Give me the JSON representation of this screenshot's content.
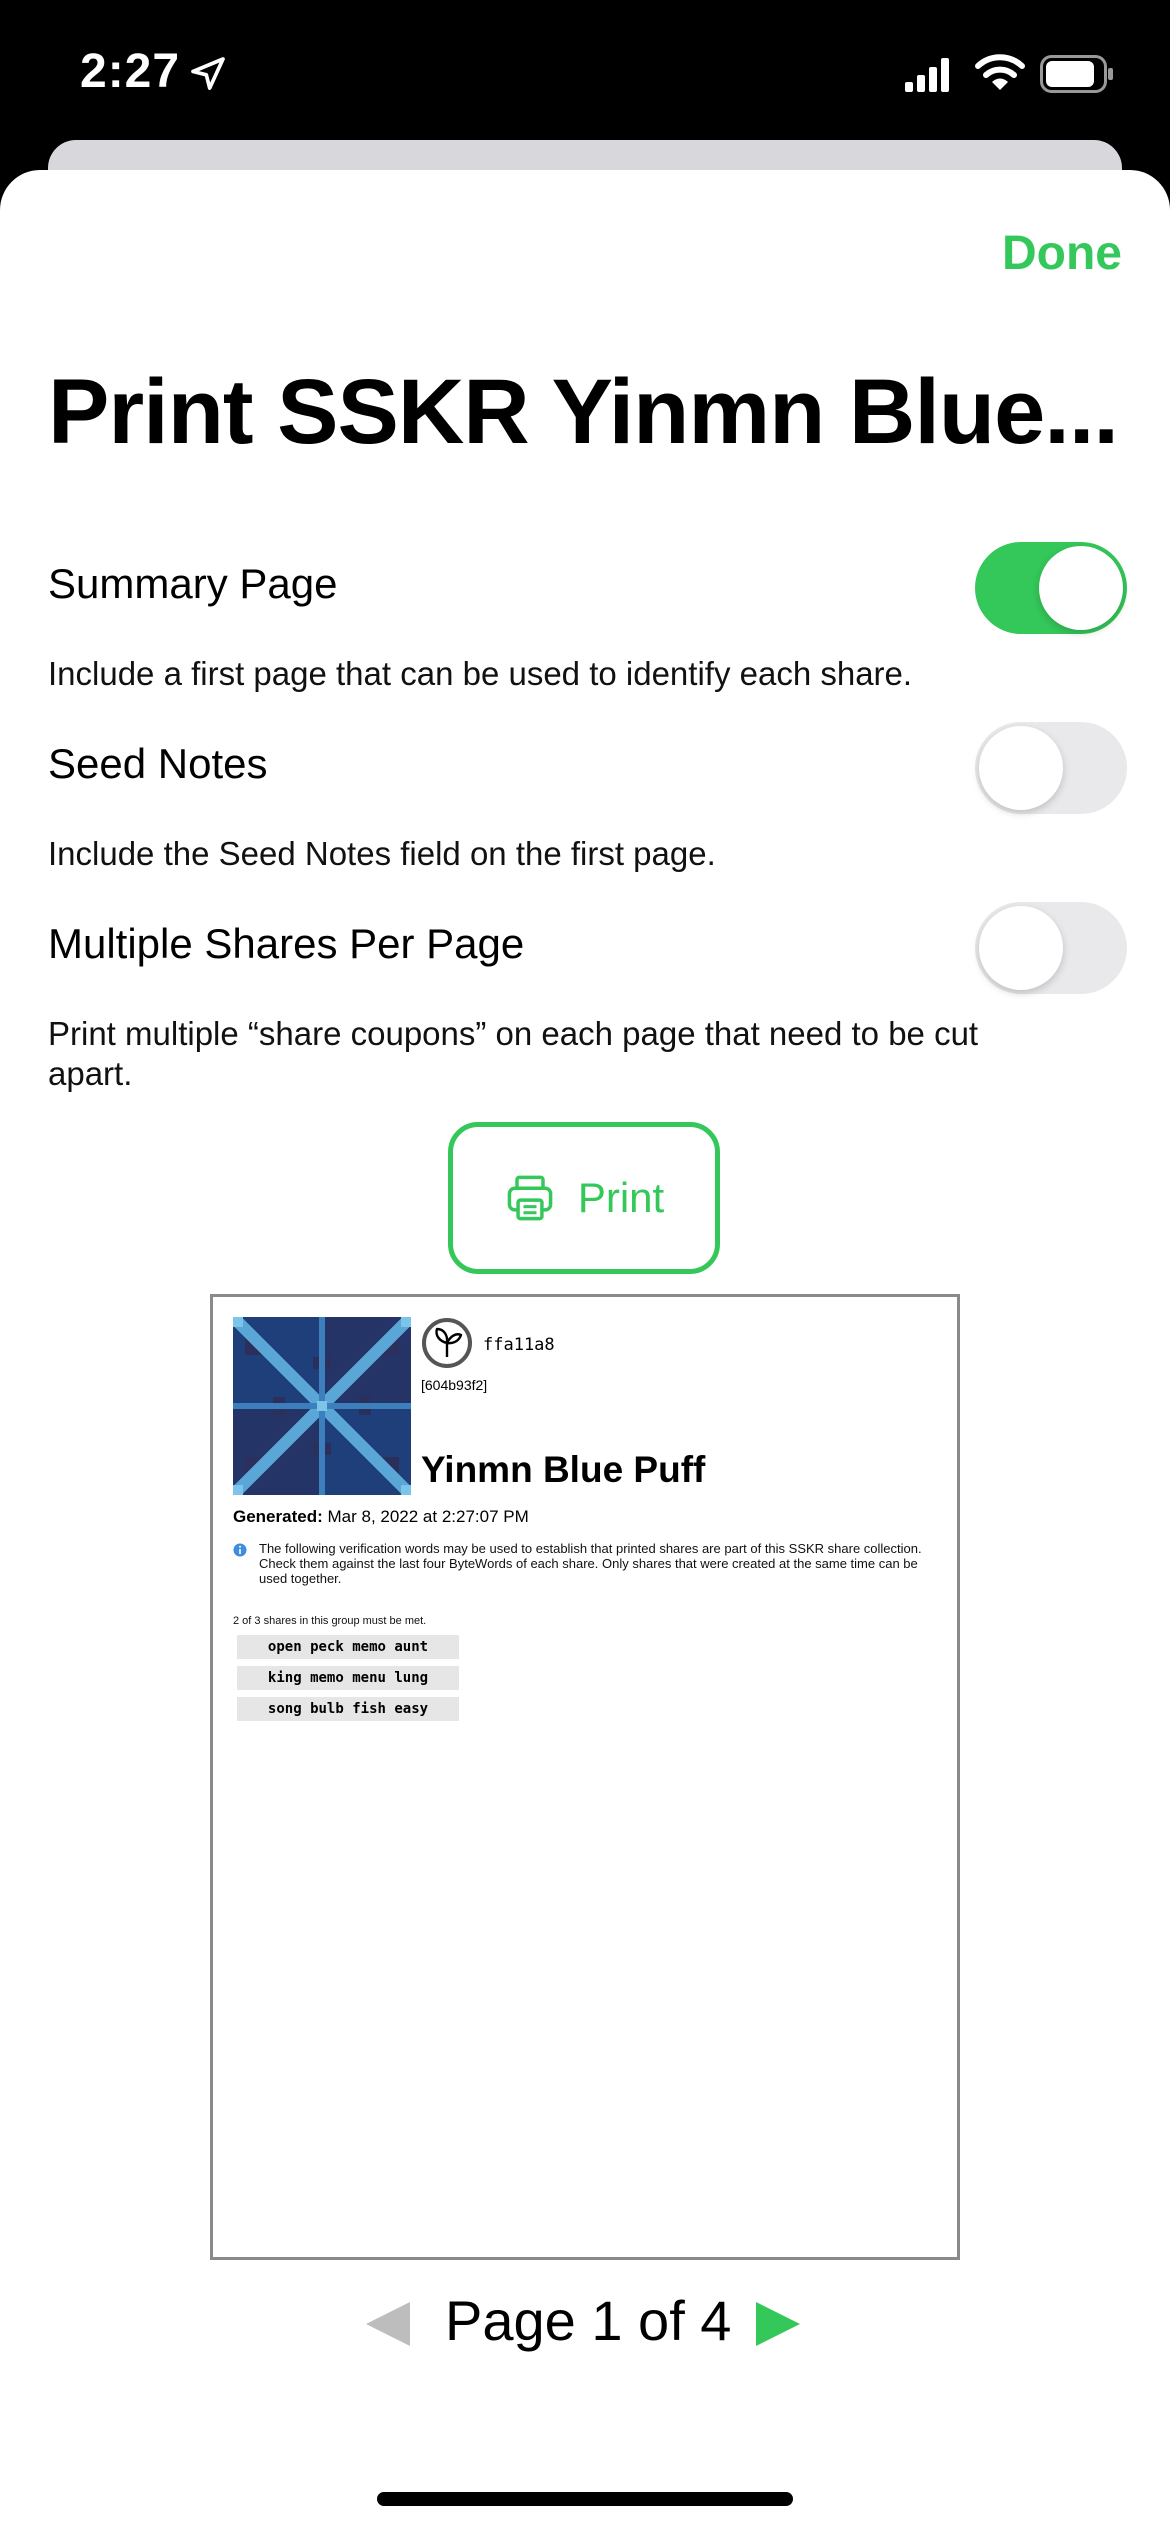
{
  "status_bar": {
    "time": "2:27"
  },
  "header": {
    "done_label": "Done",
    "title": "Print SSKR Yinmn Blue..."
  },
  "options": [
    {
      "label": "Summary Page",
      "description": "Include a first page that can be used to identify each share.",
      "enabled": true
    },
    {
      "label": "Seed Notes",
      "description": "Include the Seed Notes field on the first page.",
      "enabled": false
    },
    {
      "label": "Multiple Shares Per Page",
      "description": "Print multiple “share coupons” on each page that need to be cut apart.",
      "enabled": false
    }
  ],
  "print_button": {
    "label": "Print"
  },
  "preview": {
    "fingerprint": "ffa11a8",
    "seed_id": "[604b93f2]",
    "seed_name": "Yinmn Blue Puff",
    "generated_label": "Generated:",
    "generated_value": "Mar 8, 2022 at 2:27:07 PM",
    "verification_text": "The following verification words may be used to establish that printed shares are part of this SSKR share collection. Check them against the last four ByteWords of each share. Only shares that were created at the same time can be used together.",
    "threshold_text": "2 of 3 shares in this group must be met.",
    "words": [
      "open peck memo aunt",
      "king memo menu lung",
      "song bulb fish easy"
    ]
  },
  "pager": {
    "label": "Page 1 of 4",
    "current_page": 1,
    "total_pages": 4
  },
  "colors": {
    "accent": "#34c759",
    "toggle_off": "#e9e9eb",
    "pager_disabled": "#bdbdbd"
  }
}
